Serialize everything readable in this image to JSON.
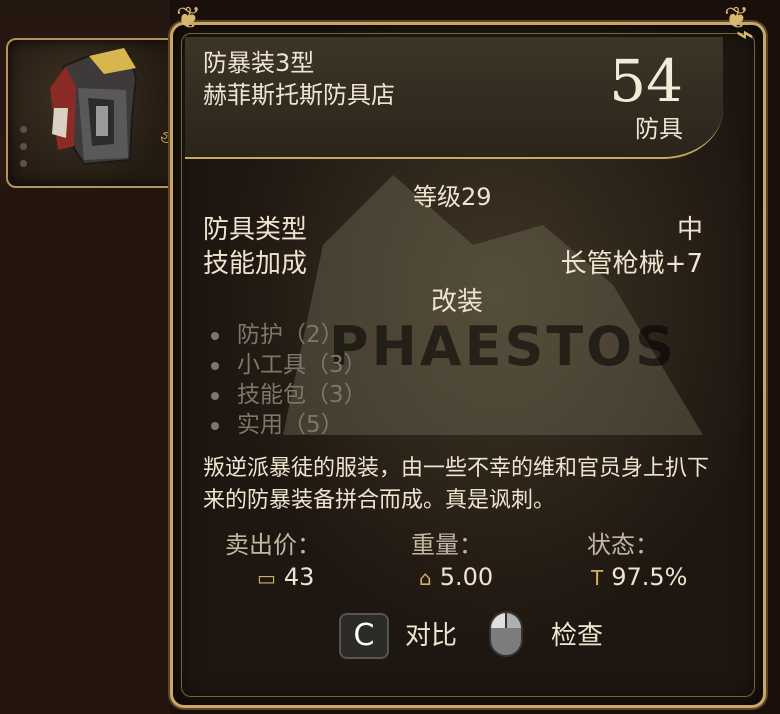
{
  "item": {
    "name": "防暴装3型",
    "source": "赫菲斯托斯防具店",
    "armor_value": "54",
    "armor_label": "防具",
    "level": "等级29",
    "armor_type_label": "防具类型",
    "armor_type_value": "中",
    "skill_bonus_label": "技能加成",
    "skill_bonus_value": "长管枪械+7",
    "mods_title": "改装",
    "mods": [
      "防护（2）",
      "小工具（3）",
      "技能包（3）",
      "实用（5）"
    ],
    "description": "叛逆派暴徒的服装，由一些不幸的维和官员身上扒下来的防暴装备拼合而成。真是讽刺。",
    "watermark": "PHAESTOS"
  },
  "stats": {
    "price_label": "卖出价：",
    "price_value": "43",
    "weight_label": "重量：",
    "weight_value": "5.00",
    "condition_label": "状态：",
    "condition_value": "97.5%"
  },
  "actions": {
    "compare_key": "C",
    "compare_label": "对比",
    "inspect_label": "检查"
  },
  "icons": {
    "price": "currency-icon",
    "weight": "weight-icon",
    "condition": "wrench-icon"
  },
  "colors": {
    "frame_gold": "#c9a767",
    "text_main": "#efe4d0",
    "text_muted": "#7d7769",
    "background": "#1e1610"
  }
}
